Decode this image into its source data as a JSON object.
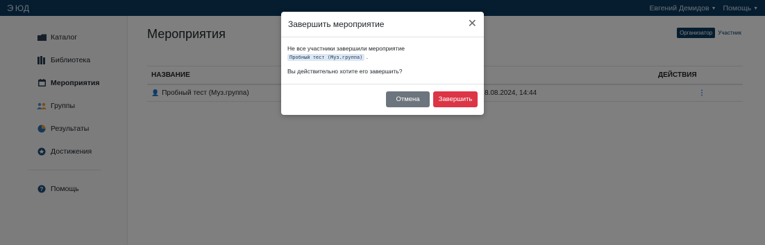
{
  "topbar": {
    "brand": "ЮД",
    "user_name": "Евгений Демидов",
    "help": "Помощь"
  },
  "sidebar": {
    "items": [
      {
        "label": "Каталог",
        "icon": "folder-icon"
      },
      {
        "label": "Библиотека",
        "icon": "books-icon"
      },
      {
        "label": "Мероприятия",
        "icon": "calendar-icon",
        "active": true
      },
      {
        "label": "Группы",
        "icon": "users-icon"
      },
      {
        "label": "Результаты",
        "icon": "pie-chart-icon"
      },
      {
        "label": "Достижения",
        "icon": "medal-icon"
      }
    ],
    "help_item": {
      "label": "Помощь",
      "icon": "question-circle-icon"
    }
  },
  "main": {
    "title": "Мероприятия",
    "roles": {
      "organizer": "Организатор",
      "participant": "Участник"
    },
    "table": {
      "headers": {
        "name": "НАЗВАНИЕ",
        "actions": "ДЕЙСТВИЯ"
      },
      "rows": [
        {
          "name": "Пробный тест (Муз.группа)",
          "date": "8.08.2024, 14:44"
        }
      ]
    }
  },
  "modal": {
    "title": "Завершить мероприятие",
    "message": "Не все участники завершили мероприятие",
    "event_name": "Пробный тест (Муз.группа)",
    "question": "Вы действительно хотите его завершить?",
    "cancel_label": "Отмена",
    "confirm_label": "Завершить"
  },
  "colors": {
    "topbar": "#0d3b60",
    "danger": "#dc3545",
    "secondary": "#6c757d",
    "link": "#0d6efd"
  }
}
